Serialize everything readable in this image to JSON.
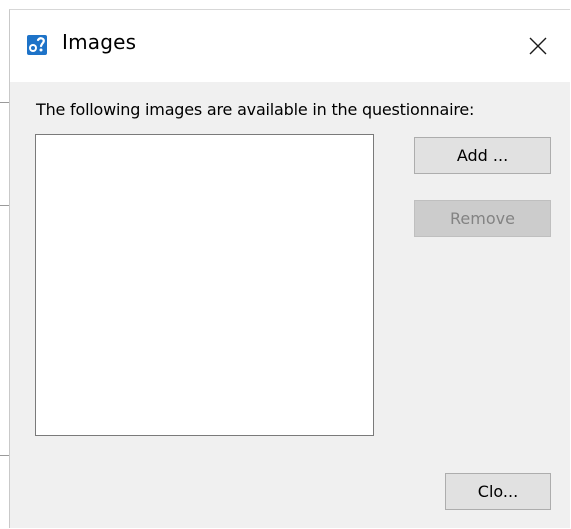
{
  "window": {
    "title": "Images",
    "icon": "questionnaire-app-icon",
    "close_icon": "close-icon"
  },
  "dialog": {
    "prompt": "The following images are available in the questionnaire:",
    "image_list": {
      "items": []
    },
    "buttons": {
      "add_label": "Add ...",
      "remove_label": "Remove",
      "remove_enabled": false,
      "close_label": "Clo..."
    }
  },
  "colors": {
    "dialog_background": "#f0f0f0",
    "titlebar_background": "#ffffff",
    "button_background": "#e1e1e1",
    "disabled_button_background": "#cccccc",
    "disabled_text": "#838383",
    "app_icon_blue": "#1e73c8"
  }
}
